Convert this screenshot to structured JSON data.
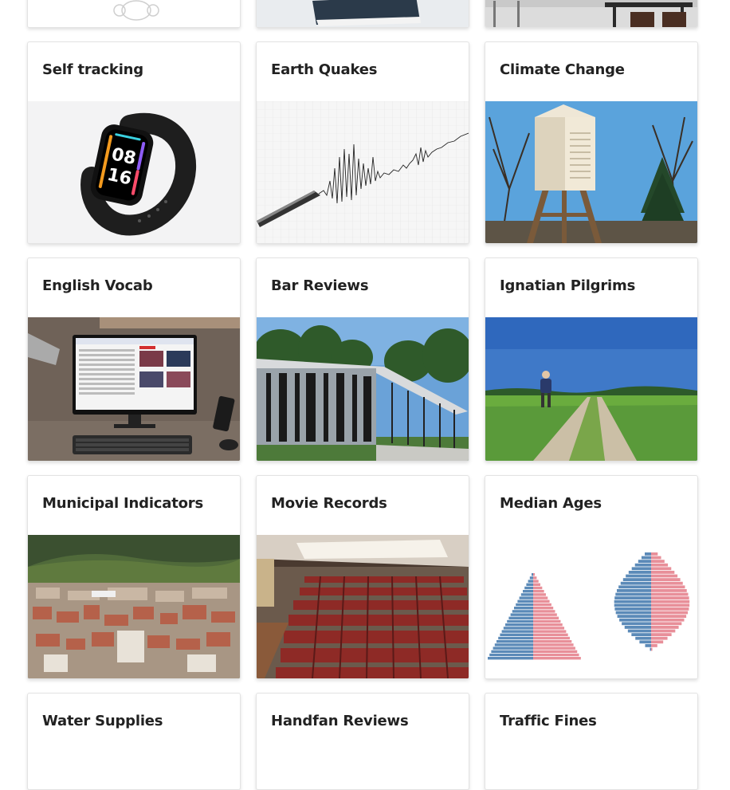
{
  "cards": [
    {
      "id": "self-tracking",
      "title": "Self tracking",
      "image": "smart-band-image"
    },
    {
      "id": "earth-quakes",
      "title": "Earth Quakes",
      "image": "seismograph-image"
    },
    {
      "id": "climate-change",
      "title": "Climate Change",
      "image": "weather-station-image"
    },
    {
      "id": "english-vocab",
      "title": "English Vocab",
      "image": "computer-desk-image"
    },
    {
      "id": "bar-reviews",
      "title": "Bar Reviews",
      "image": "modern-building-image"
    },
    {
      "id": "ignatian-pilgrims",
      "title": "Ignatian Pilgrims",
      "image": "pilgrim-path-image"
    },
    {
      "id": "municipal-indicators",
      "title": "Municipal Indicators",
      "image": "town-aerial-image"
    },
    {
      "id": "movie-records",
      "title": "Movie Records",
      "image": "cinema-seats-image"
    },
    {
      "id": "median-ages",
      "title": "Median Ages",
      "image": "population-pyramids-image"
    },
    {
      "id": "water-supplies",
      "title": "Water Supplies"
    },
    {
      "id": "handfan-reviews",
      "title": "Handfan Reviews"
    },
    {
      "id": "traffic-fines",
      "title": "Traffic Fines"
    }
  ],
  "colors": {
    "male": "#5b8ab8",
    "female": "#e88f99",
    "card_border": "#e3e3e3"
  }
}
